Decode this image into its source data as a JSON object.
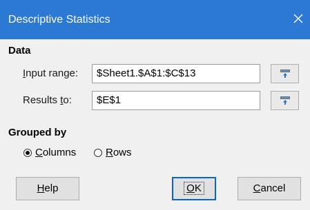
{
  "window": {
    "title": "Descriptive Statistics",
    "close_icon": "close-icon",
    "accent_color": "#2b79d3"
  },
  "data_section": {
    "heading": "Data",
    "input_range": {
      "label_underlined": "I",
      "label_rest": "nput range:",
      "value": "$Sheet1.$A$1:$C$13",
      "shrink_icon": "shrink-icon"
    },
    "results_to": {
      "label_rest": "Results ",
      "label_underlined": "t",
      "label_tail": "o:",
      "value": "$E$1",
      "shrink_icon": "shrink-icon"
    }
  },
  "grouped_by": {
    "heading": "Grouped by",
    "options": [
      {
        "underlined": "C",
        "rest": "olumns",
        "selected": true
      },
      {
        "underlined": "R",
        "rest": "ows",
        "selected": false
      }
    ]
  },
  "buttons": {
    "help": {
      "underlined": "H",
      "rest": "elp"
    },
    "ok": {
      "underlined": "O",
      "rest": "K"
    },
    "cancel": {
      "underlined": "C",
      "rest": "ancel"
    }
  }
}
